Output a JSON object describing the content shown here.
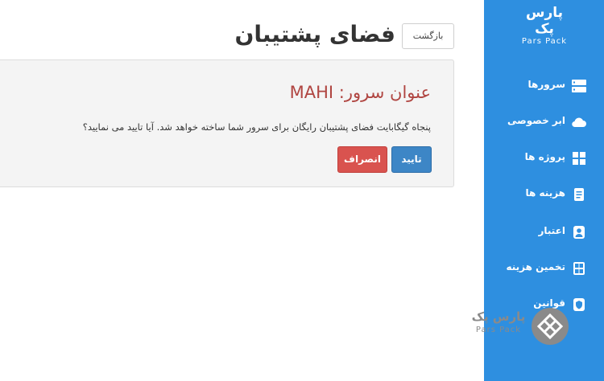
{
  "brand": {
    "name_fa": "پارس پک",
    "name_en": "Pars Pack"
  },
  "sidebar": {
    "items": [
      {
        "label": "سرورها",
        "icon": "server-icon"
      },
      {
        "label": "ابر خصوصی",
        "icon": "cloud-icon"
      },
      {
        "label": "پروژه ها",
        "icon": "projects-grid-icon"
      },
      {
        "label": "هزینه ها",
        "icon": "invoice-icon"
      },
      {
        "label": "اعتبار",
        "icon": "credit-user-icon"
      },
      {
        "label": "تخمین هزینه",
        "icon": "calculator-icon"
      },
      {
        "label": "قوانین",
        "icon": "rules-shield-icon"
      }
    ]
  },
  "header": {
    "title": "فضای پشتیبان",
    "back_label": "بازگشت"
  },
  "panel": {
    "title": "عنوان سرور: MAHI",
    "message": "پنجاه گیگابایت فضای پشتیبان رایگان برای سرور شما ساخته خواهد شد. آیا تایید می نمایید؟",
    "confirm_label": "تایید",
    "cancel_label": "انصراف"
  },
  "colors": {
    "sidebar": "#2e8fe0",
    "title_red": "#b04541",
    "confirm": "#3d86c6",
    "cancel": "#d9534f",
    "panel_bg": "#f4f4f4"
  }
}
